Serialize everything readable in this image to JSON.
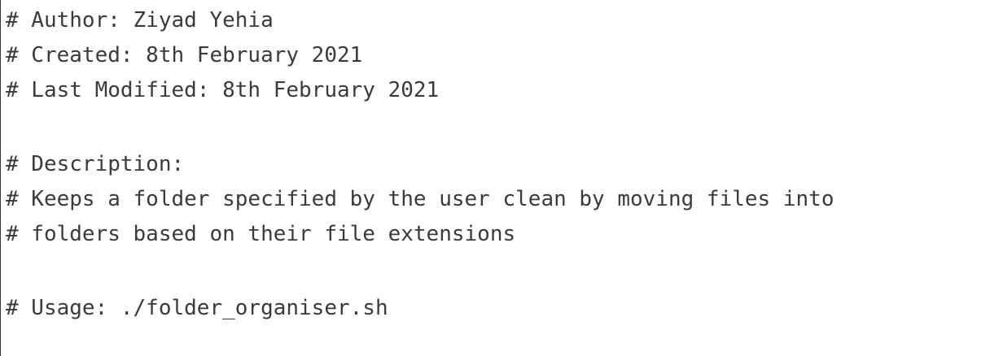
{
  "code": {
    "lines": [
      "# Author: Ziyad Yehia",
      "# Created: 8th February 2021",
      "# Last Modified: 8th February 2021",
      "# Description:",
      "# Keeps a folder specified by the user clean by moving files into",
      "# folders based on their file extensions",
      "# Usage: ./folder_organiser.sh"
    ]
  },
  "colors": {
    "text": "#3b3b3b",
    "background": "#ffffff",
    "border": "#3a3a3a"
  }
}
